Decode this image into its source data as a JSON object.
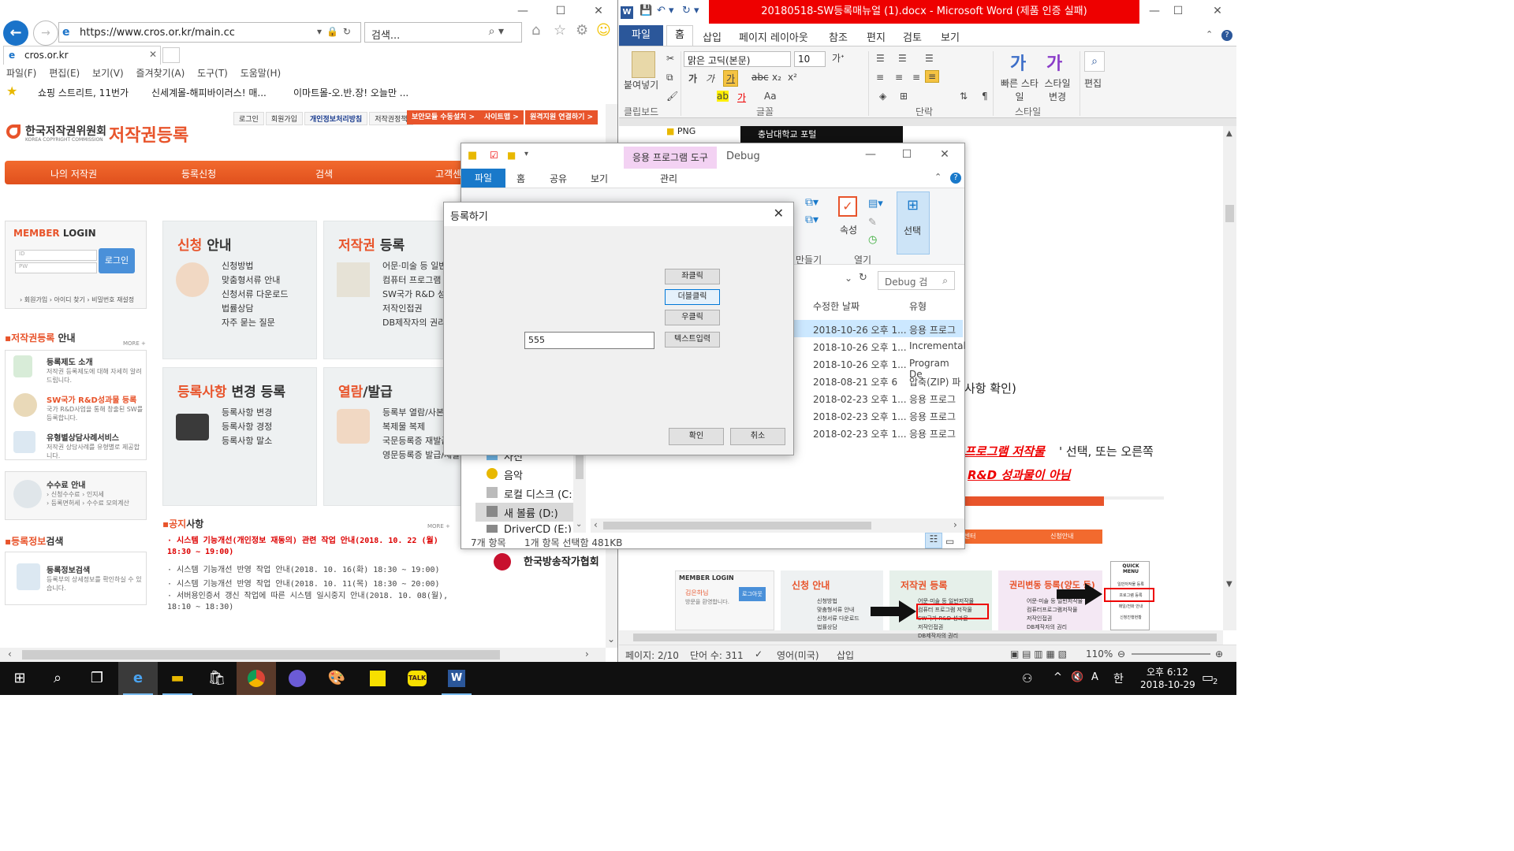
{
  "ie": {
    "address_url": "https://www.cros.or.kr/main.cc",
    "search_placeholder": "검색...",
    "tab_title": "cros.or.kr",
    "menu": [
      "파일(F)",
      "편집(E)",
      "보기(V)",
      "즐겨찾기(A)",
      "도구(T)",
      "도움말(H)"
    ],
    "favorites": [
      "쇼핑 스트리트, 11번가",
      "신세계몰-해피바이러스! 매...",
      "이마트몰-오.반.장! 오늘만 ..."
    ]
  },
  "cros": {
    "logo_ko": "한국저작권위원회",
    "logo_en": "KOREA COPYRIGHT COMMISSION",
    "logo_reg": "저작권등록",
    "top_links": [
      "로그인",
      "회원가입",
      "개인정보처리방침",
      "저작권정책"
    ],
    "top_buttons": [
      "보안모듈 수동설치 >",
      "사이트맵 >",
      "원격지원 연결하기 >"
    ],
    "nav": [
      "나의 저작권",
      "등록신청",
      "검색",
      "고객센"
    ],
    "login_title_1": "MEMBER",
    "login_title_2": " LOGIN",
    "login_id": "ID",
    "login_pw": "PW",
    "login_button": "로그인",
    "login_links": "› 회원가입 › 아이디 찾기 › 비밀번호 재설정",
    "sec1_title_o": "저작권등록",
    "sec1_title": " 안내",
    "more": "MORE +",
    "items": [
      {
        "h": "등록제도 소개",
        "d": "저작권 등록제도에 대해 자세히 알려드립니다."
      },
      {
        "h": "SW국가 R&D성과물 등록",
        "d": "국가 R&D사업을 통해 창출된 SW를 등록합니다."
      },
      {
        "h": "유형별상담사례서비스",
        "d": "저작권 상담사례를 유형별로 제공합니다."
      }
    ],
    "fee": {
      "h": "수수료 안내",
      "l1": "› 신청수수료 › 인지세",
      "l2": "› 등록면허세 › 수수료 모의계산"
    },
    "sec2_title_o": "등록정보",
    "sec2_title": "검색",
    "search_item": {
      "h": "등록정보검색",
      "d": "등록부의 상세정보를 확인하실 수 있습니다."
    },
    "tiles": [
      {
        "o": "신청",
        "b": " 안내",
        "list": [
          "신청방법",
          "맞춤형서류 안내",
          "신청서류 다운로드",
          "법률상담",
          "자주 묻는 질문"
        ]
      },
      {
        "o": "저작권",
        "b": " 등록",
        "list": [
          "어문·미술 등 일반저",
          "컴퓨터 프로그램 저",
          "SW국가 R&D 성과",
          "저작인접권",
          "DB제작자의 권리"
        ]
      },
      {
        "o": "등록사항",
        "b": " 변경 등록",
        "list": [
          "등록사항 변경",
          "등록사항 경정",
          "등록사항 말소"
        ]
      },
      {
        "o": "열람",
        "b": "/발급",
        "list": [
          "등록부 열람/사본",
          "복제물 복제",
          "국문등록증 재발급",
          "영문등록증 발급/재발"
        ]
      }
    ],
    "notice_o": "공지",
    "notice": "사항",
    "notices": [
      "· 시스템 기능개선(개인정보 재동의) 관련 작업 안내(2018. 10. 22 (월) 18:30 ~ 19:00)",
      "· 시스템 기능개선 반영 작업 안내(2018. 10. 16(화) 18:30 ~ 19:00)",
      "· 시스템 기능개선 반영 작업 안내(2018. 10. 11(목) 18:30 ~ 20:00)",
      "· 서버용인증서 갱신 작업에 따른 시스템 일시중지 안내(2018. 10. 08(월), 18:10 ~ 18:30)"
    ]
  },
  "word": {
    "title": "20180518-SW등록매뉴얼 (1).docx - Microsoft Word (제품 인증 실패)",
    "tabs": [
      "파일",
      "홈",
      "삽입",
      "페이지 레이아웃",
      "참조",
      "편지",
      "검토",
      "보기"
    ],
    "font": "맑은 고딕(본문)",
    "size": "10",
    "groups": [
      "클립보드",
      "글꼴",
      "단락",
      "스타일"
    ],
    "paste": "붙여넣기",
    "quick_style": "빠른 스타일",
    "style_change": "스타일 변경",
    "edit": "편집",
    "doc_lines": [
      "사항 확인)",
      "프로그램 저작물",
      "' 선택, 또는 오른쪽",
      "R&D 성과물이 아님"
    ],
    "embed": {
      "member_login": "MEMBER LOGIN",
      "user": "김은하님",
      "welcome": "방문을 환영합니다.",
      "logout": "로그아웃",
      "tile1": "신청 안내",
      "tile1_list": [
        "신청방법",
        "맞춤형서류 안내",
        "신청서류 다운로드",
        "법률상담"
      ],
      "tile2": "저작권 등록",
      "tile2_list": [
        "어문·미술 등 일반저작물",
        "컴퓨터 프로그램 저작물",
        "SW국가 R&D 성과물",
        "저작인접권",
        "DB제작자의 권리"
      ],
      "tile3": "권리변동 등록(양도 등)",
      "tile3_list": [
        "어문·미술 등 일반저작물",
        "컴퓨터프로그램저작물",
        "저작인접권",
        "DB제작자의 권리"
      ],
      "quick": "QUICK MENU",
      "quick_items": [
        "일반저작물 등록",
        "프로그램 등록",
        "매일/전화 안내",
        "신청진행현황"
      ],
      "tabs": [
        "고객센터",
        "신청안내"
      ]
    },
    "status": {
      "page": "페이지: 2/10",
      "words": "단어 수: 311",
      "lang": "영어(미국)",
      "mode": "삽입",
      "zoom": "110%"
    }
  },
  "explorer": {
    "ctx_tab": "응용 프로그램 도구",
    "title": "Debug",
    "tabs": [
      "파일",
      "홈",
      "공유",
      "보기"
    ],
    "manage": "관리",
    "ribbon": {
      "new_folder": "만들기",
      "open": "열기",
      "props": "속성",
      "select": "선택"
    },
    "search": "Debug 검",
    "cols": [
      "수정한 날짜",
      "유형"
    ],
    "files": [
      {
        "date": "2018-10-26 오후 1...",
        "type": "응용 프로그"
      },
      {
        "date": "2018-10-26 오후 1...",
        "type": "Incremental"
      },
      {
        "date": "2018-10-26 오후 1...",
        "type": "Program De"
      },
      {
        "date": "2018-08-21 오후 6",
        "type": "압축(ZIP) 파"
      },
      {
        "date": "2018-02-23 오후 1...",
        "type": "응용 프로그"
      },
      {
        "date": "2018-02-23 오후 1...",
        "type": "응용 프로그"
      },
      {
        "date": "2018-02-23 오후 1...",
        "type": "응용 프로그"
      }
    ],
    "nav": [
      "사진",
      "음악",
      "로컬 디스크 (C:)",
      "새 볼륨 (D:)",
      "DriverCD (E:)"
    ],
    "status_count": "7개 항목",
    "status_sel": "1개 항목 선택함 481KB",
    "bg_folder": "PNG",
    "bg_dark": "충남대학교 포털",
    "ad": "한국방송작가협회"
  },
  "dialog": {
    "title": "등록하기",
    "buttons": [
      "좌클릭",
      "더블클릭",
      "우클릭",
      "텍스트입력"
    ],
    "input_value": "555",
    "ok": "확인",
    "cancel": "취소"
  },
  "taskbar": {
    "time": "오후 6:12",
    "date": "2018-10-29",
    "ime": "한",
    "notif_count": "2"
  }
}
